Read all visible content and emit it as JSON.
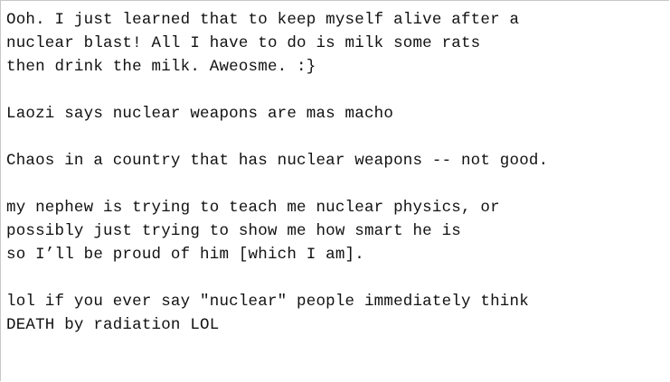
{
  "document": {
    "lines": [
      "Ooh. I just learned that to keep myself alive after a",
      "nuclear blast! All I have to do is milk some rats",
      "then drink the milk. Aweosme. :}",
      "",
      "Laozi says nuclear weapons are mas macho",
      "",
      "Chaos in a country that has nuclear weapons -- not good.",
      "",
      "my nephew is trying to teach me nuclear physics, or",
      "possibly just trying to show me how smart he is",
      "so I’ll be proud of him [which I am].",
      "",
      "lol if you ever say \"nuclear\" people immediately think",
      "DEATH by radiation LOL"
    ]
  }
}
